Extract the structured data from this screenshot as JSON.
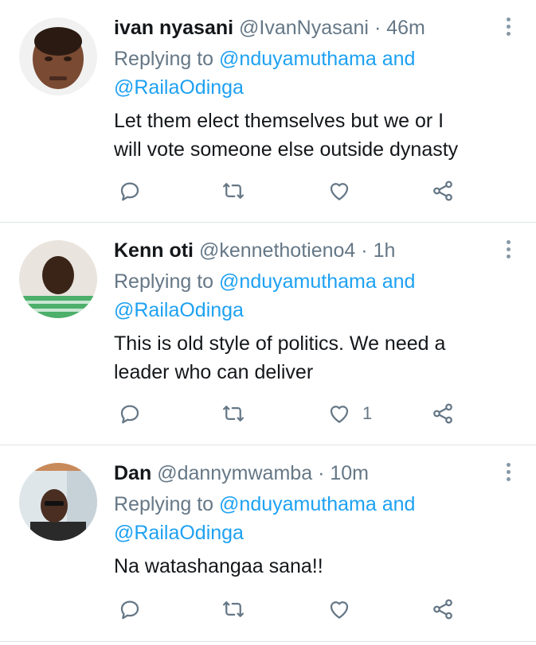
{
  "tweets": [
    {
      "name": "ivan nyasani",
      "handle": "@IvanNyasani",
      "dot": "·",
      "time": "46m",
      "replying_prefix": "Replying to",
      "mention1": "@nduyamuthama",
      "and": "and",
      "mention2": "@RailaOdinga",
      "body_line1": "Let them elect themselves but we or I",
      "body_line2": "will vote someone else  outside dynasty",
      "like_count": ""
    },
    {
      "name": "Kenn oti",
      "handle": "@kennethotieno4",
      "dot": "·",
      "time": "1h",
      "replying_prefix": "Replying to",
      "mention1": "@nduyamuthama",
      "and": "and",
      "mention2": "@RailaOdinga",
      "body_line1": "This is old style of politics. We need a",
      "body_line2": "leader who can deliver",
      "like_count": "1"
    },
    {
      "name": "Dan",
      "handle": "@dannymwamba",
      "dot": "·",
      "time": "10m",
      "replying_prefix": "Replying to",
      "mention1": "@nduyamuthama",
      "and": "and",
      "mention2": "@RailaOdinga",
      "body_line1": "Na watashangaa sana!!",
      "body_line2": "",
      "like_count": ""
    }
  ],
  "icons": [
    "reply-icon",
    "retweet-icon",
    "like-icon",
    "share-icon",
    "more-icon"
  ],
  "colors": {
    "link": "#1da1f2",
    "muted": "#657786",
    "text": "#14171a",
    "divider": "#dfe3e6"
  }
}
